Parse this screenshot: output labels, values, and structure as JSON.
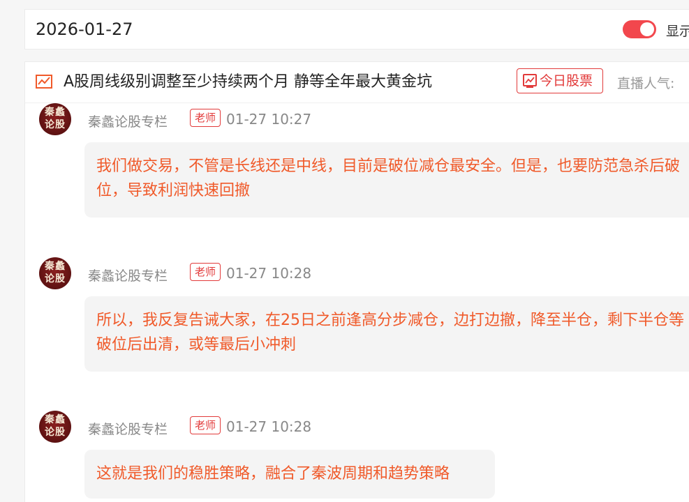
{
  "date_bar": {
    "date": "2026-01-27",
    "toggle_on": true,
    "toggle_label": "显示"
  },
  "header": {
    "title": "A股周线级别调整至少持续两个月 静等全年最大黄金坑",
    "stock_button": "今日股票",
    "popularity_label": "直播人气:"
  },
  "colors": {
    "accent_red": "#e23a3a",
    "message_text": "#f05a2a",
    "toggle_on": "#f2474d"
  },
  "messages": [
    {
      "avatar_text": "秦蠡论股",
      "author": "秦蠡论股专栏",
      "role": "老师",
      "time": "01-27 10:27",
      "text": "我们做交易，不管是长线还是中线，目前是破位减仓最安全。但是，也要防范急杀后破位，导致利润快速回撤"
    },
    {
      "avatar_text": "秦蠡论股",
      "author": "秦蠡论股专栏",
      "role": "老师",
      "time": "01-27 10:28",
      "text": "所以，我反复告诫大家，在25日之前逢高分步减仓，边打边撤，降至半仓，剩下半仓等破位后出清，或等最后小冲刺"
    },
    {
      "avatar_text": "秦蠡论股",
      "author": "秦蠡论股专栏",
      "role": "老师",
      "time": "01-27 10:28",
      "text": "这就是我们的稳胜策略，融合了秦波周期和趋势策略"
    }
  ]
}
